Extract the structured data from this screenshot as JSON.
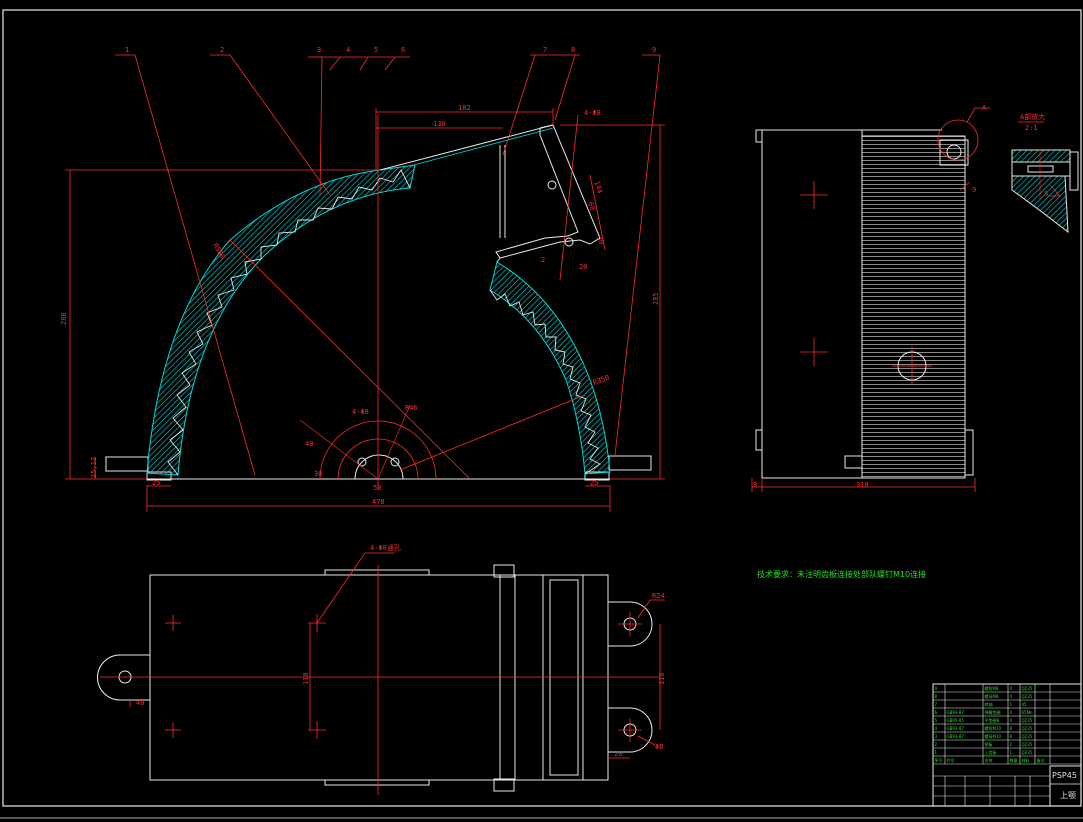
{
  "front_view": {
    "leaders": [
      "1",
      "2",
      "3",
      "4",
      "5",
      "6",
      "7",
      "8",
      "9"
    ],
    "dims": {
      "top_182": "182",
      "top_130": "130",
      "left_h": "280",
      "right_h": "285",
      "bottom_w": "478",
      "left_small": "25",
      "right_small": "25",
      "left_side": "25,12",
      "arc_r1": "R500",
      "arc_r2": "R350",
      "center_r": "R46",
      "center_d": "4-Φ8",
      "center_40": "40",
      "center_30": "30",
      "center_50": "50",
      "plate_144": "144",
      "plate_60": "60",
      "plate_30": "30",
      "plate_20": "20",
      "plate_hole": "4-Φ8",
      "plate_2": "2"
    }
  },
  "side_view": {
    "label_a": "A",
    "label_9": "9",
    "width": "310",
    "left": "8"
  },
  "detail": {
    "title": "A部放大",
    "scale": "2:1",
    "label": "8"
  },
  "plan_view": {
    "leader_note": "4-Φ8通孔",
    "dim_110_left": "110",
    "dim_110_right": "110",
    "dim_r": "R24",
    "dim_20": "20",
    "dim_40": "40",
    "dim_phi": "Φ8"
  },
  "notes": {
    "tech": "技术要求：未注明齿板连接处部队螺钉M10连接"
  },
  "title_block": {
    "rows": [
      [
        "9",
        "",
        "螺栓M8",
        "4",
        "Q235",
        ""
      ],
      [
        "8",
        "",
        "螺母M8",
        "4",
        "Q235",
        ""
      ],
      [
        "7",
        "",
        "转轴",
        "1",
        "45",
        ""
      ],
      [
        "6",
        "GB93-87",
        "弹簧垫圈",
        "4",
        "65Mn",
        ""
      ],
      [
        "5",
        "GB95-85",
        "平垫圈8",
        "4",
        "Q235",
        ""
      ],
      [
        "4",
        "GB93-87",
        "螺栓M10",
        "8",
        "Q235",
        ""
      ],
      [
        "3",
        "GB93-87",
        "螺母M10",
        "8",
        "Q235",
        ""
      ],
      [
        "2",
        "",
        "侧板",
        "2",
        "Q235",
        ""
      ],
      [
        "1",
        "",
        "上齿板",
        "1",
        "Q235",
        ""
      ]
    ],
    "header": [
      "序号",
      "代号",
      "名称",
      "数量",
      "材料",
      "备注"
    ],
    "drawing_no": "PSP45",
    "name": "上颚"
  }
}
